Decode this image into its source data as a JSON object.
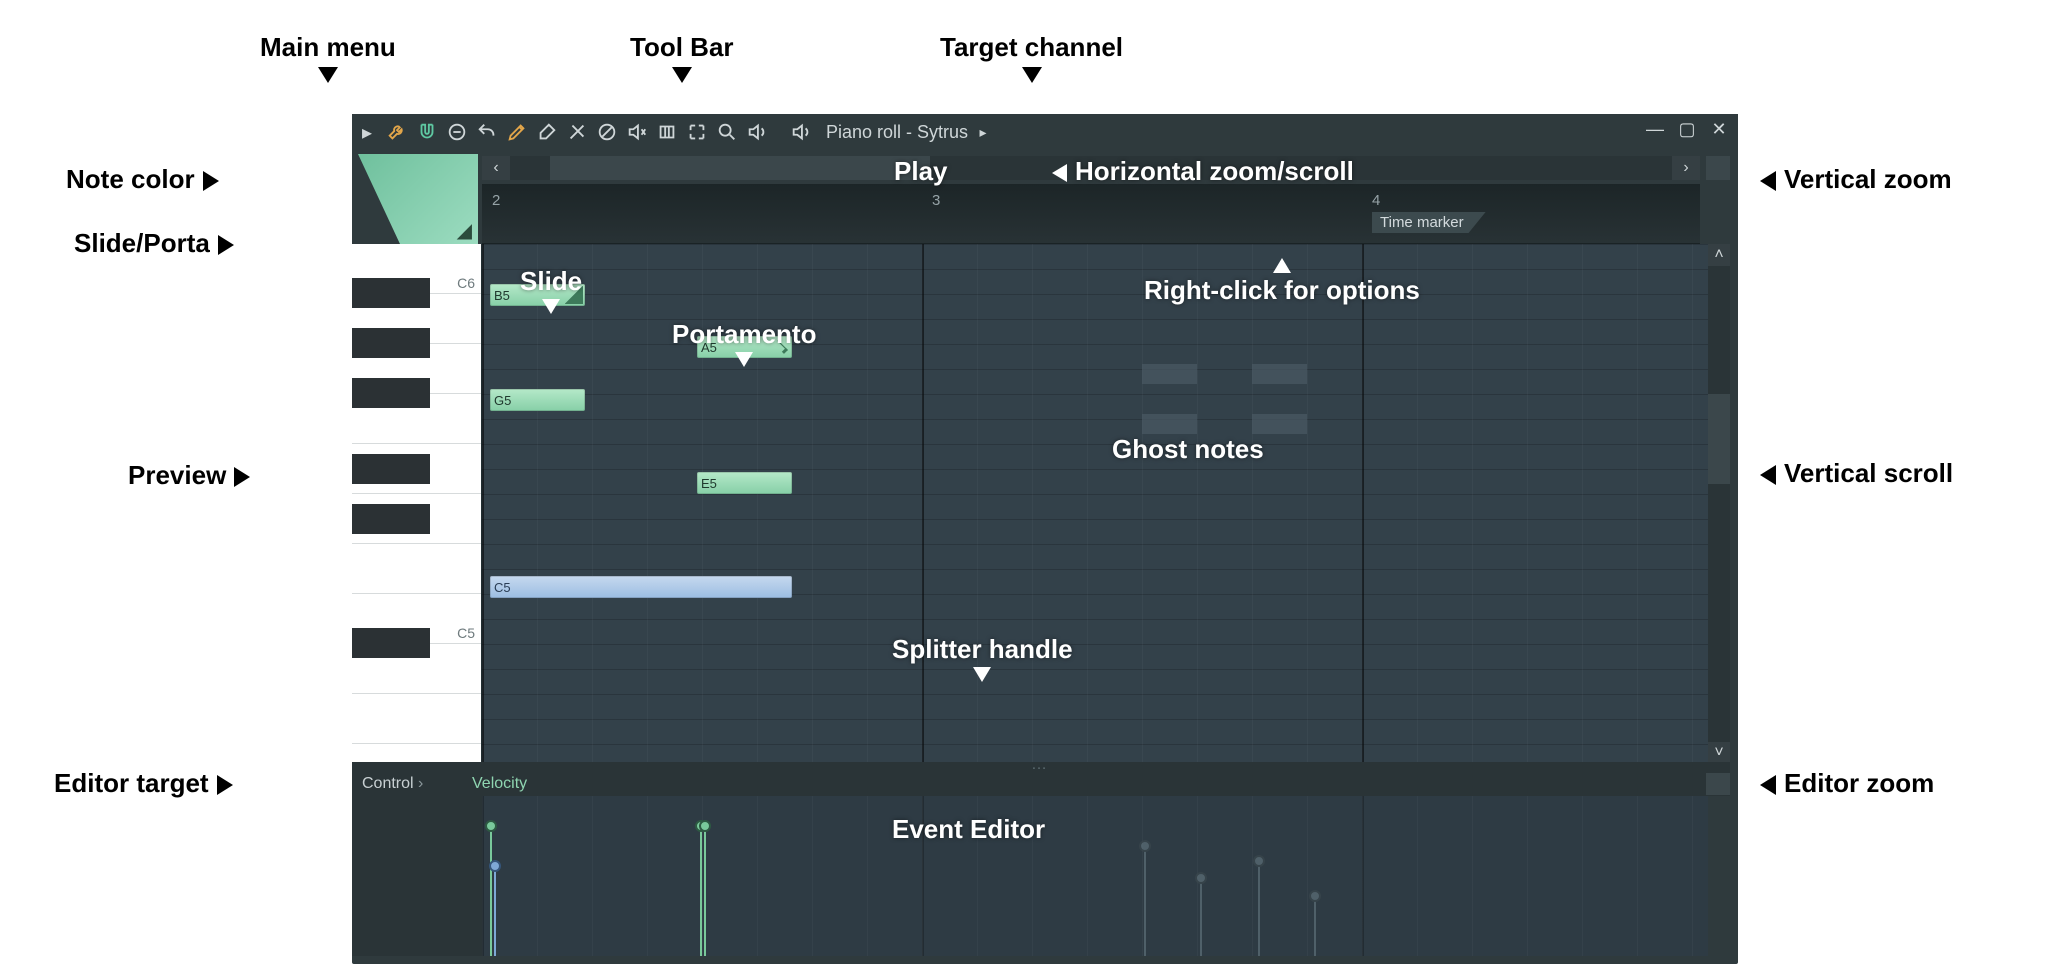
{
  "toolbar": {
    "title": "Piano roll - Sytrus"
  },
  "timeline": {
    "bars": [
      "2",
      "3",
      "4"
    ],
    "marker_label": "Time marker"
  },
  "keys": {
    "c6_label": "C6",
    "c5_label": "C5"
  },
  "notes": {
    "b5": "B5",
    "g5": "G5",
    "a5": "A5",
    "e5": "E5",
    "c5": "C5"
  },
  "event_editor": {
    "control_label": "Control",
    "param_label": "Velocity"
  },
  "ann": {
    "main_menu": "Main menu",
    "tool_bar": "Tool Bar",
    "target_channel": "Target channel",
    "note_color": "Note color",
    "slide_porta": "Slide/Porta",
    "preview": "Preview",
    "editor_target": "Editor target",
    "vertical_zoom": "Vertical zoom",
    "vertical_scroll": "Vertical scroll",
    "editor_zoom": "Editor zoom",
    "play": "Play",
    "hzoom": "Horizontal zoom/scroll",
    "slide": "Slide",
    "portamento": "Portamento",
    "ghost_notes": "Ghost notes",
    "right_click": "Right-click for options",
    "splitter": "Splitter handle",
    "event_editor": "Event Editor"
  }
}
